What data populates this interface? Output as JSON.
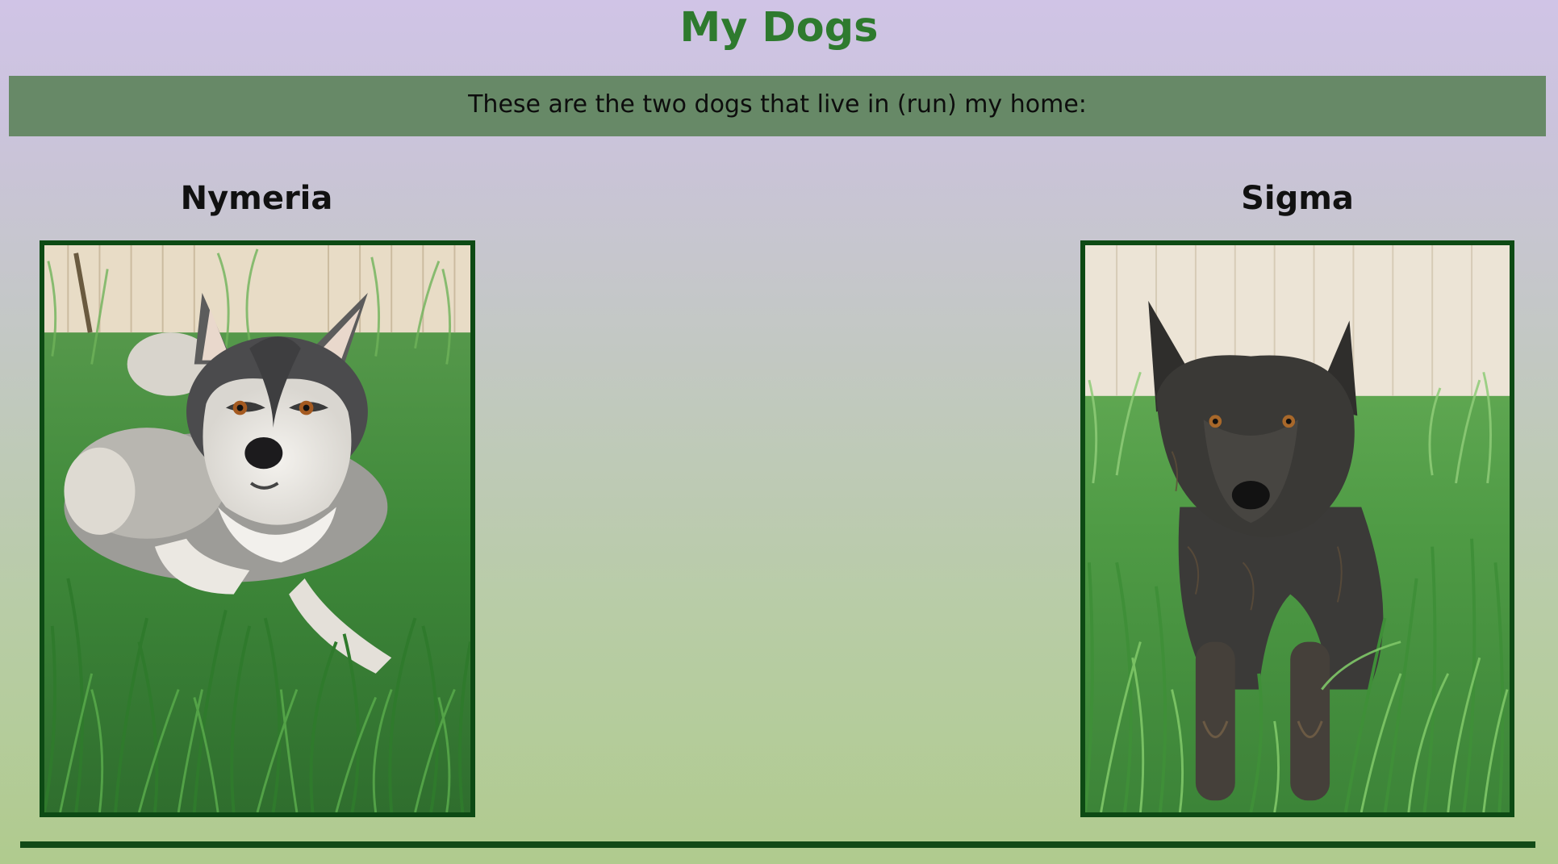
{
  "page": {
    "title": "My Dogs",
    "intro": "These are the two dogs that live in (run) my home:"
  },
  "colors": {
    "title": "#2e7a2e",
    "banner_background": "#678967",
    "frame_border": "#0d4a14",
    "divider": "#124a17",
    "background_top": "#d0c4e6",
    "background_bottom": "#b0cb8e"
  },
  "dogs": [
    {
      "name": "Nymeria",
      "photo_subject": "husky-photo"
    },
    {
      "name": "Sigma",
      "photo_subject": "black-shepherd-photo"
    }
  ]
}
